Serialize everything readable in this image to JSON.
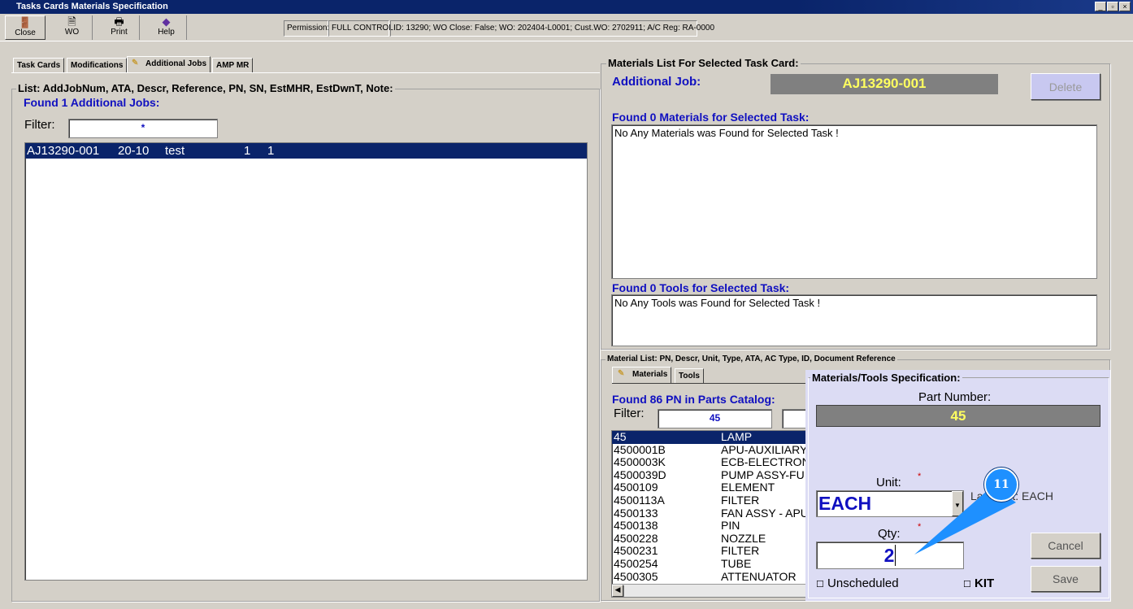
{
  "window": {
    "title": "Tasks Cards Materials Specification",
    "controls": [
      "_",
      "▫",
      "×"
    ]
  },
  "toolbar": {
    "close": "Close",
    "wo": "WO",
    "print": "Print",
    "help": "Help",
    "permission_label": "Permission:",
    "permission_value": "FULL CONTROL",
    "info": "ID: 13290; WO Close: False; WO: 202404-L0001; Cust.WO: 2702911; A/C Reg: RA-0000"
  },
  "tabs": [
    "Task Cards",
    "Modifications",
    "Additional Jobs",
    "AMP MR"
  ],
  "left": {
    "group_title": "List: AddJobNum, ATA, Descr, Reference, PN, SN, EstMHR, EstDwnT, Note:",
    "found": "Found 1 Additional Jobs:",
    "filter_label": "Filter:",
    "filter_value": "*",
    "rows": [
      {
        "num": "AJ13290-001",
        "ata": "20-10",
        "descr": "test",
        "mhr": "1",
        "dwnt": "1"
      }
    ]
  },
  "right": {
    "group_title": "Materials List For Selected Task Card:",
    "job_label": "Additional Job:",
    "job_value": "AJ13290-001",
    "delete": "Delete",
    "materials_found": "Found 0 Materials for Selected Task:",
    "materials_msg": "No Any Materials was Found for Selected Task !",
    "tools_found": "Found 0 Tools for Selected Task:",
    "tools_msg": "No Any Tools was Found for Selected Task !"
  },
  "catalog": {
    "group_title": "Material List: PN, Descr, Unit, Type, ATA, AC Type, ID, Document Reference",
    "tabs": [
      "Materials",
      "Tools"
    ],
    "found": "Found 86 PN in Parts Catalog:",
    "filter_label": "Filter:",
    "filter_value": "45",
    "rows": [
      [
        "45",
        "LAMP"
      ],
      [
        "4500001B",
        "APU-AUXILIARY"
      ],
      [
        "4500003K",
        "ECB-ELECTRON"
      ],
      [
        "4500039D",
        "PUMP ASSY-FU"
      ],
      [
        "4500109",
        "ELEMENT"
      ],
      [
        "4500113A",
        "FILTER"
      ],
      [
        "4500133",
        "FAN ASSY - APU"
      ],
      [
        "4500138",
        "PIN"
      ],
      [
        "4500228",
        "NOZZLE"
      ],
      [
        "4500231",
        "FILTER"
      ],
      [
        "4500254",
        "TUBE"
      ],
      [
        "4500305",
        "ATTENUATOR"
      ]
    ]
  },
  "spec": {
    "title": "Materials/Tools Specification:",
    "pn_label": "Part Number:",
    "pn_value": "45",
    "unit_label": "Unit:",
    "unit_value": "EACH",
    "last_unit": "Last Unit: EACH",
    "qty_label": "Qty:",
    "qty_value": "2",
    "required": "*",
    "unscheduled": "Unscheduled",
    "kit": "KIT",
    "cancel": "Cancel",
    "save": "Save"
  },
  "callout": {
    "number": "11",
    "color": "#1e90ff"
  }
}
